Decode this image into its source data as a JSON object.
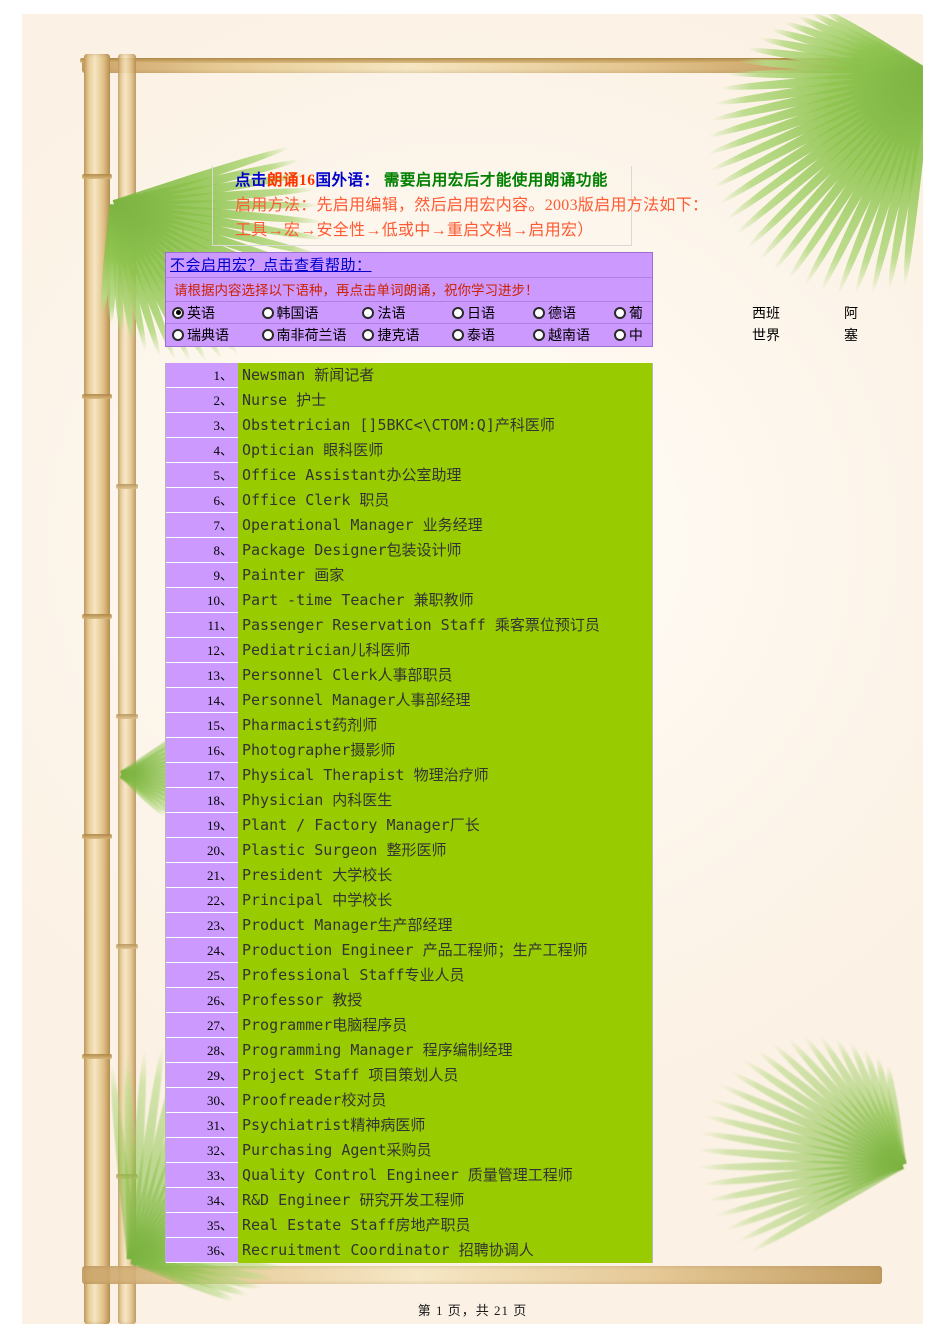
{
  "header": {
    "title_parts": [
      {
        "text": "点击",
        "color": "#0000cc"
      },
      {
        "text": "朗诵",
        "color": "#ff3300"
      },
      {
        "text": "16",
        "color": "#ff3300"
      },
      {
        "text": "国外语：",
        "color": "#0000cc"
      },
      {
        "text": "  需要启用宏后才能使用朗诵功能",
        "color": "#008000"
      }
    ],
    "line2": "启用方法：先启用编辑，然后启用宏内容。2003版启用方法如下：",
    "line3": "工具→宏→安全性→低或中→重启文档→启用宏）"
  },
  "selector": {
    "help_link": "不会启用宏？点击查看帮助：",
    "instruction": "请根据内容选择以下语种，再点击单词朗诵，祝你学习进步！",
    "rows": [
      [
        {
          "label": "英语",
          "checked": true
        },
        {
          "label": "韩国语",
          "checked": false
        },
        {
          "label": "法语",
          "checked": false
        },
        {
          "label": "日语",
          "checked": false
        },
        {
          "label": "德语",
          "checked": false
        },
        {
          "label": "葡",
          "checked": false
        }
      ],
      [
        {
          "label": "瑞典语",
          "checked": false
        },
        {
          "label": "南非荷兰语",
          "checked": false
        },
        {
          "label": "捷克语",
          "checked": false
        },
        {
          "label": "泰语",
          "checked": false
        },
        {
          "label": "越南语",
          "checked": false
        },
        {
          "label": "中",
          "checked": false
        }
      ]
    ],
    "overflow": [
      {
        "a": "西班",
        "b": "阿"
      },
      {
        "a": "世界",
        "b": "塞"
      }
    ]
  },
  "word_list": [
    {
      "num": "1、",
      "text": "Newsman 新闻记者"
    },
    {
      "num": "2、",
      "text": "Nurse 护士"
    },
    {
      "num": "3、",
      "text": "Obstetrician  []5BKC<\\CTOM:Q]产科医师"
    },
    {
      "num": "4、",
      "text": "Optician 眼科医师"
    },
    {
      "num": "5、",
      "text": "Office Assistant办公室助理"
    },
    {
      "num": "6、",
      "text": "Office Clerk 职员"
    },
    {
      "num": "7、",
      "text": "Operational Manager  业务经理"
    },
    {
      "num": "8、",
      "text": "Package Designer包装设计师"
    },
    {
      "num": "9、",
      "text": "Painter 画家"
    },
    {
      "num": "10、",
      "text": "Part -time Teacher  兼职教师"
    },
    {
      "num": "11、",
      "text": "Passenger Reservation Staff 乘客票位预订员"
    },
    {
      "num": "12、",
      "text": "Pediatrician儿科医师"
    },
    {
      "num": "13、",
      "text": "Personnel Clerk人事部职员"
    },
    {
      "num": "14、",
      "text": "Personnel Manager人事部经理"
    },
    {
      "num": "15、",
      "text": "Pharmacist药剂师"
    },
    {
      "num": "16、",
      "text": "Photographer摄影师"
    },
    {
      "num": "17、",
      "text": "Physical Therapist  物理治疗师"
    },
    {
      "num": "18、",
      "text": "Physician 内科医生"
    },
    {
      "num": "19、",
      "text": "Plant / Factory Manager厂长"
    },
    {
      "num": "20、",
      "text": "Plastic Surgeon  整形医师"
    },
    {
      "num": "21、",
      "text": "President 大学校长"
    },
    {
      "num": "22、",
      "text": "Principal 中学校长"
    },
    {
      "num": "23、",
      "text": "Product Manager生产部经理"
    },
    {
      "num": "24、",
      "text": "Production Engineer  产品工程师；生产工程师"
    },
    {
      "num": "25、",
      "text": "Professional Staff专业人员"
    },
    {
      "num": "26、",
      "text": "Professor 教授"
    },
    {
      "num": "27、",
      "text": "Programmer电脑程序员"
    },
    {
      "num": "28、",
      "text": "Programming Manager 程序编制经理"
    },
    {
      "num": "29、",
      "text": "Project Staff 项目策划人员"
    },
    {
      "num": "30、",
      "text": "Proofreader校对员"
    },
    {
      "num": "31、",
      "text": "Psychiatrist精神病医师"
    },
    {
      "num": "32、",
      "text": "Purchasing Agent采购员"
    },
    {
      "num": "33、",
      "text": "Quality Control Engineer 质量管理工程师"
    },
    {
      "num": "34、",
      "text": "R&D Engineer  研究开发工程师"
    },
    {
      "num": "35、",
      "text": "Real Estate Staff房地产职员"
    },
    {
      "num": "36、",
      "text": "Recruitment Coordinator 招聘协调人"
    }
  ],
  "footer": {
    "page_indicator": "第 1 页，共 21 页"
  },
  "theme": {
    "list_green": "#99cc00",
    "panel_purple": "#cc99ff",
    "link_blue": "#0000cc",
    "warn_red": "#ff3300",
    "warn_green": "#008000"
  }
}
